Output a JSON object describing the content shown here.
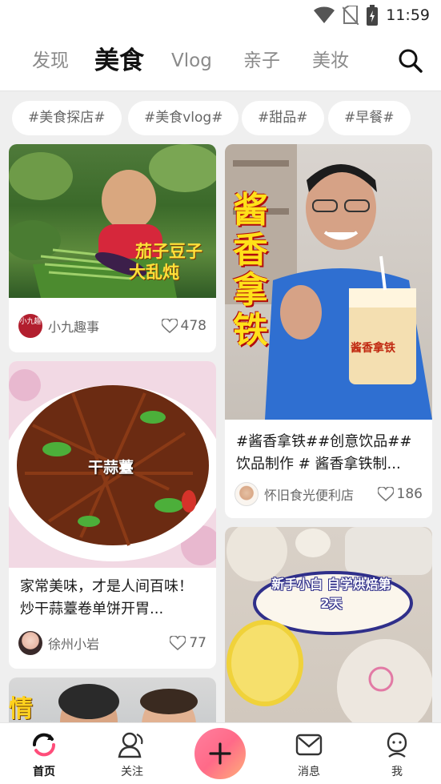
{
  "status_bar": {
    "time": "11:59"
  },
  "top_tabs": [
    {
      "label": "发现"
    },
    {
      "label": "美食"
    },
    {
      "label": "Vlog"
    },
    {
      "label": "亲子"
    },
    {
      "label": "美妆"
    }
  ],
  "tags": [
    "#美食探店#",
    "#美食vlog#",
    "#甜品#",
    "#早餐#"
  ],
  "feed": {
    "card1": {
      "overlay_line1": "茄子豆子",
      "overlay_line2": "大乱炖",
      "avatar_text": "小九趣",
      "author": "小九趣事",
      "likes": "478"
    },
    "card2": {
      "title": "家常美味，才是人间百味！炒干蒜薹卷单饼开胃...",
      "overlay": "干蒜薹",
      "author": "徐州小岩",
      "likes": "77"
    },
    "card3": {
      "overlay_partial": "情"
    },
    "card4": {
      "overlay_big": "酱香拿铁",
      "cup_label": "酱香拿铁",
      "title": "#酱香拿铁##创意饮品##饮品制作 # 酱香拿铁制...",
      "author": "怀旧食光便利店",
      "likes": "186"
    },
    "card5": {
      "overlay": "新手小白 自学烘焙第2天"
    }
  },
  "bottom_nav": [
    {
      "label": "首页"
    },
    {
      "label": "关注"
    },
    {
      "label": "消息"
    },
    {
      "label": "我"
    }
  ],
  "colors": {
    "accent": "#ff6a88",
    "like": "#666666"
  }
}
